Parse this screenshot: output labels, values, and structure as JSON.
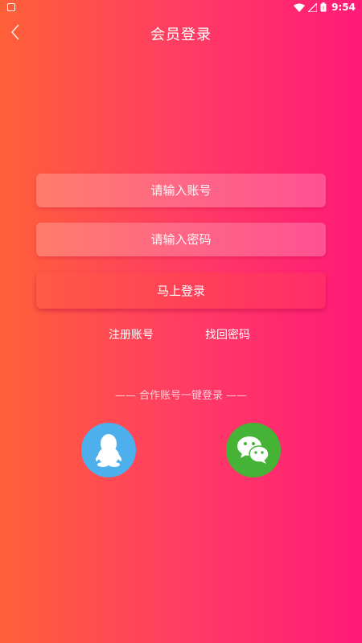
{
  "status_bar": {
    "time": "9:54"
  },
  "header": {
    "title": "会员登录"
  },
  "form": {
    "account_placeholder": "请输入账号",
    "password_placeholder": "请输入密码",
    "login_label": "马上登录"
  },
  "links": {
    "register": "注册账号",
    "forgot_password": "找回密码"
  },
  "third_party": {
    "caption": "—— 合作账号一键登录 ——",
    "providers": [
      {
        "icon": "qq-icon",
        "color": "#4db0ec"
      },
      {
        "icon": "wechat-icon",
        "color": "#44b336"
      }
    ]
  },
  "colors": {
    "gradient_start": "#ff6038",
    "gradient_end": "#ff1a78"
  }
}
